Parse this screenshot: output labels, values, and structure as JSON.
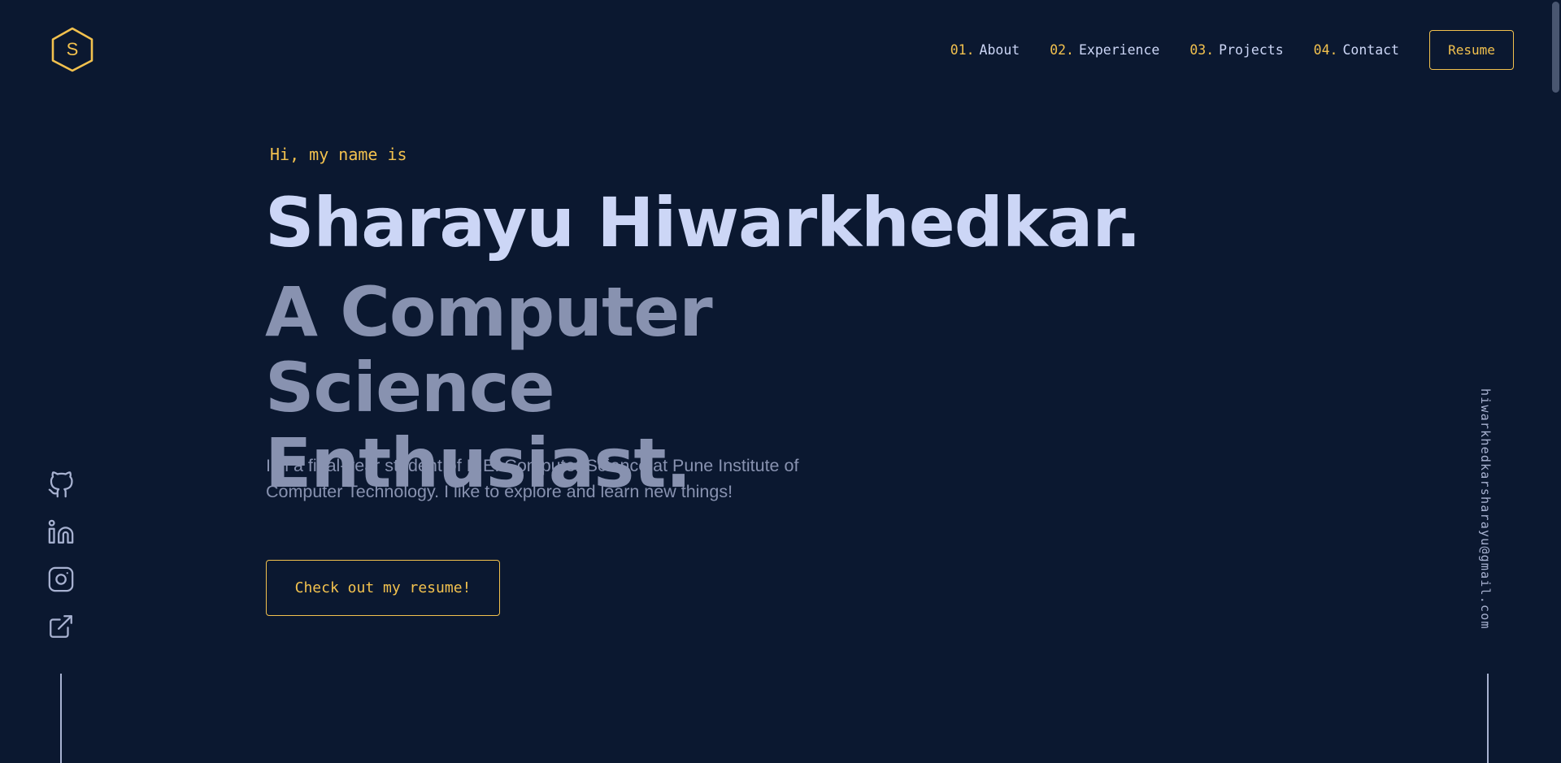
{
  "logo": {
    "letter": "S"
  },
  "nav": {
    "items": [
      {
        "num": "01.",
        "label": "About"
      },
      {
        "num": "02.",
        "label": "Experience"
      },
      {
        "num": "03.",
        "label": "Projects"
      },
      {
        "num": "04.",
        "label": "Contact"
      }
    ],
    "resume_label": "Resume"
  },
  "hero": {
    "greeting": "Hi, my name is",
    "name": "Sharayu Hiwarkhedkar.",
    "tagline": "A Computer Science Enthusiast.",
    "bio": "I'm a final-year student of B.E. Computer Science at Pune Institute of Computer Technology. I like to explore and learn new things!",
    "cta_label": "Check out my resume!"
  },
  "social": {
    "icons": [
      "github-icon",
      "linkedin-icon",
      "instagram-icon",
      "external-link-icon"
    ]
  },
  "email": "hiwarkhedkarsharayu@gmail.com",
  "colors": {
    "background": "#0b1830",
    "accent": "#f2c14e",
    "heading": "#ccd6f6",
    "muted": "#8892b0"
  }
}
